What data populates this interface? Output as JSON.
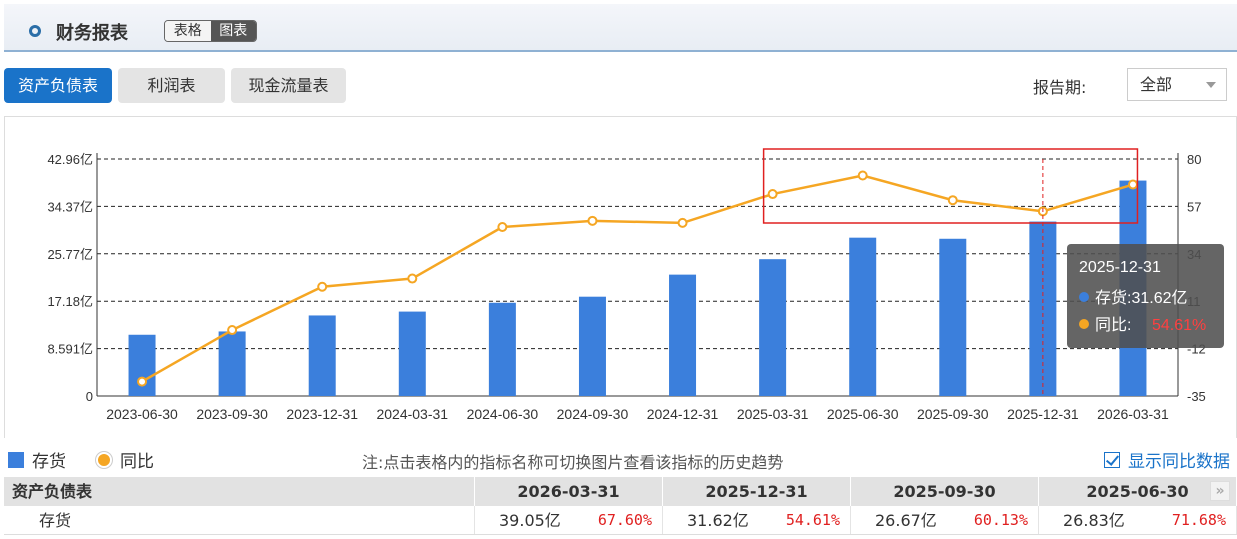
{
  "header": {
    "title": "财务报表",
    "view_table": "表格",
    "view_chart": "图表"
  },
  "tabs": [
    {
      "label": "资产负债表",
      "active": true
    },
    {
      "label": "利润表",
      "active": false
    },
    {
      "label": "现金流量表",
      "active": false
    }
  ],
  "period": {
    "label": "报告期:",
    "value": "全部"
  },
  "legend": {
    "bar_label": "存货",
    "line_label": "同比"
  },
  "note": "注:点击表格内的指标名称可切换图片查看该指标的历史趋势",
  "show_yoy_label": "显示同比数据",
  "colors": {
    "bar": "#3b7fdc",
    "line": "#f5a623",
    "highlight_box": "#e02020",
    "active_tab": "#1a73c9"
  },
  "chart_data": {
    "type": "bar+line",
    "categories": [
      "2023-06-30",
      "2023-09-30",
      "2023-12-31",
      "2024-03-31",
      "2024-06-30",
      "2024-09-30",
      "2024-12-31",
      "2025-03-31",
      "2025-06-30",
      "2025-09-30",
      "2025-12-31",
      "2026-03-31"
    ],
    "series": [
      {
        "name": "存货",
        "type": "bar",
        "axis": "left",
        "values": [
          11.1,
          11.7,
          14.6,
          15.3,
          16.9,
          18.0,
          22.0,
          24.8,
          28.7,
          28.5,
          31.62,
          39.05
        ]
      },
      {
        "name": "同比",
        "type": "line",
        "axis": "right",
        "values": [
          -28,
          -3,
          18,
          22,
          47,
          50,
          49,
          63,
          72,
          60,
          54.61,
          67.6
        ]
      }
    ],
    "y_left": {
      "ticks": [
        "0",
        "8.591亿",
        "17.18亿",
        "25.77亿",
        "34.37亿",
        "42.96亿"
      ],
      "max": 42.96
    },
    "y_right": {
      "ticks": [
        "-35",
        "-12",
        "11",
        "34",
        "57",
        "80"
      ],
      "min": -35,
      "max": 80
    },
    "grid": true,
    "tooltip": {
      "date": "2025-12-31",
      "inventory_label": "存货:",
      "inventory_value": "31.62亿",
      "yoy_label": "同比:",
      "yoy_value": "54.61%"
    }
  },
  "table": {
    "header": [
      "资产负债表",
      "2026-03-31",
      "2025-12-31",
      "2025-09-30",
      "2025-06-30"
    ],
    "rows": [
      {
        "name": "存货",
        "cells": [
          {
            "value": "39.05亿",
            "pct": "67.60%"
          },
          {
            "value": "31.62亿",
            "pct": "54.61%"
          },
          {
            "value": "26.67亿",
            "pct": "60.13%"
          },
          {
            "value": "26.83亿",
            "pct": "71.68%"
          }
        ]
      }
    ]
  }
}
